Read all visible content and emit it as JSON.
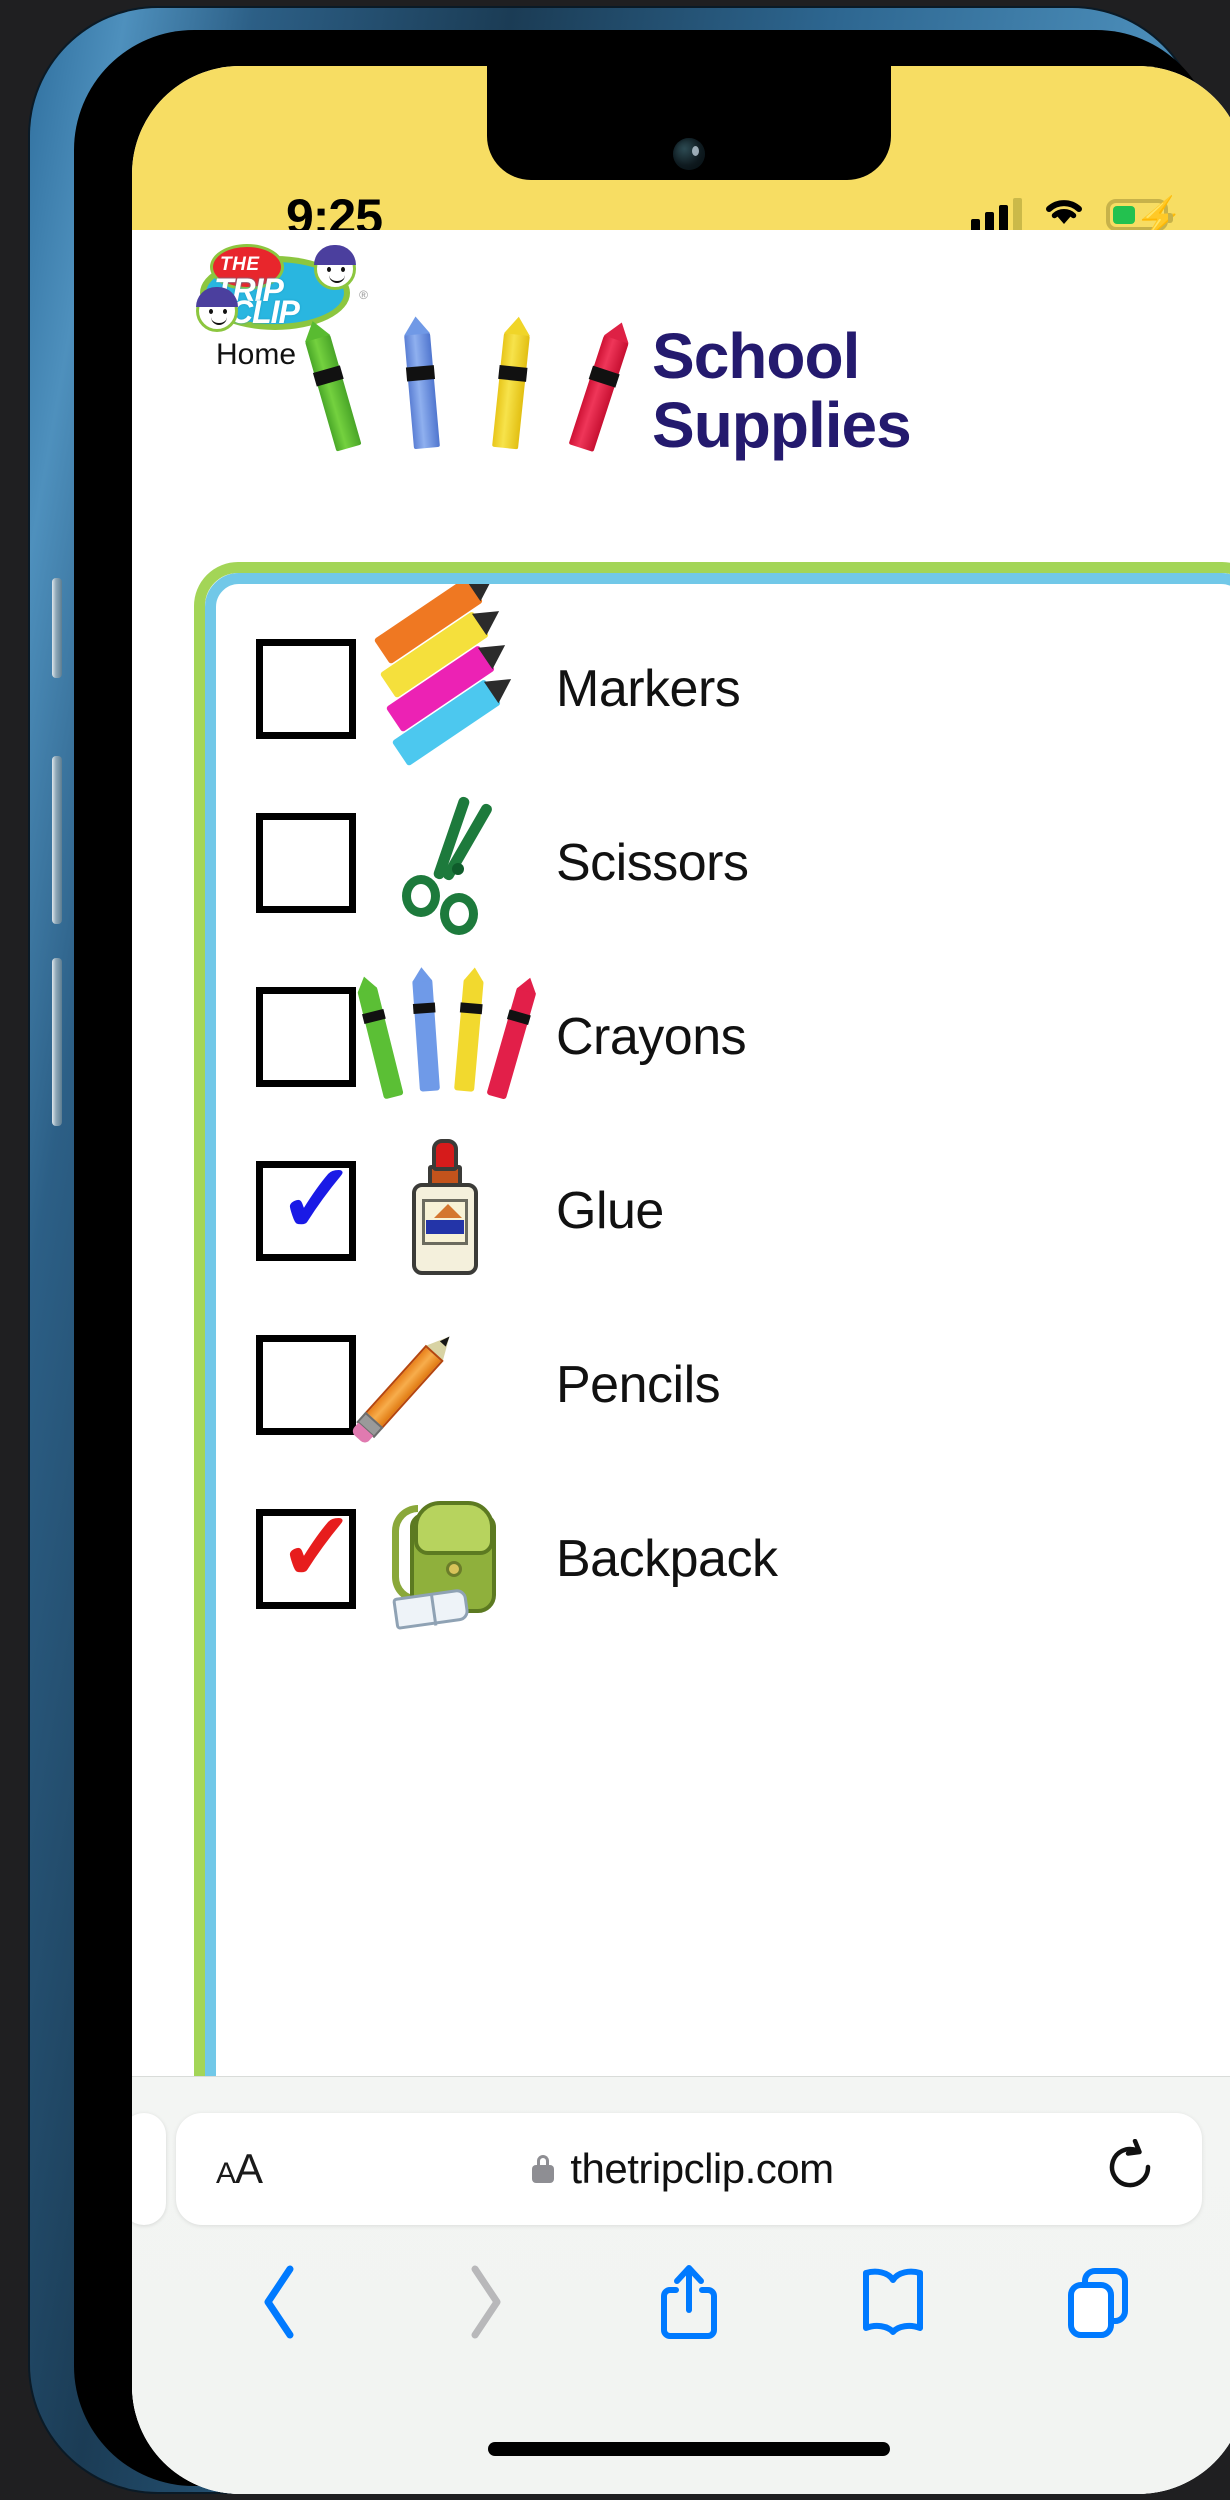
{
  "status_bar": {
    "time": "9:25",
    "cellular_icon": "cellular-signal-icon",
    "cellular_bars_filled": 3,
    "cellular_bars_total": 4,
    "wifi_icon": "wifi-icon",
    "battery_icon": "battery-charging-icon",
    "battery_charging": true,
    "background_color": "#f7dd63"
  },
  "header": {
    "logo": {
      "name": "the-trip-clip-logo",
      "word_the": "THE",
      "word_trip": "TRIP",
      "word_clip": "CLIP",
      "registered_mark": "®"
    },
    "home_label": "Home",
    "crayon_art": "crayons-illustration",
    "title": "School Supplies",
    "title_color": "#241a6e"
  },
  "card": {
    "outer_border_color": "#a3d557",
    "inner_border_color": "#71c8e8",
    "items": [
      {
        "label": "Markers",
        "checked": false,
        "check_color": "",
        "icon": "markers-image"
      },
      {
        "label": "Scissors",
        "checked": false,
        "check_color": "",
        "icon": "scissors-image"
      },
      {
        "label": "Crayons",
        "checked": false,
        "check_color": "",
        "icon": "crayons-image"
      },
      {
        "label": "Glue",
        "checked": true,
        "check_color": "#1a1ae6",
        "icon": "glue-bottle-image",
        "check_glyph": "✓"
      },
      {
        "label": "Pencils",
        "checked": false,
        "check_color": "",
        "icon": "pencil-image"
      },
      {
        "label": "Backpack",
        "checked": true,
        "check_color": "#e71d1d",
        "icon": "backpack-image",
        "check_glyph": "✓"
      }
    ]
  },
  "browser": {
    "text_size_small": "A",
    "text_size_big": "A",
    "lock_icon": "lock-icon",
    "url": "thetripclip.com",
    "reload_icon": "reload-icon",
    "toolbar": {
      "back_icon": "back-chevron-icon",
      "forward_icon": "forward-chevron-icon",
      "share_icon": "share-icon",
      "bookmarks_icon": "bookmarks-icon",
      "tabs_icon": "tabs-icon",
      "back_enabled": true,
      "forward_enabled": false,
      "accent_color": "#007aff",
      "disabled_color": "#b8b8ba"
    }
  }
}
